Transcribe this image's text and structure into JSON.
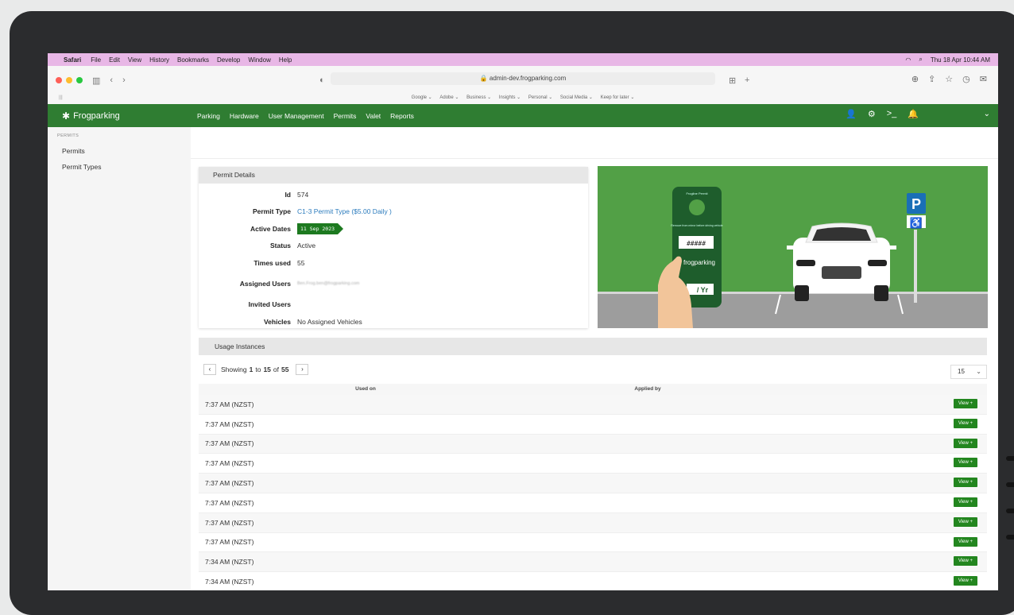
{
  "menubar": {
    "app": "Safari",
    "items": [
      "File",
      "Edit",
      "View",
      "History",
      "Bookmarks",
      "Develop",
      "Window",
      "Help"
    ],
    "clock": "Thu 18 Apr  10:44 AM"
  },
  "browser": {
    "url": "admin-dev.frogparking.com",
    "bookmarks": [
      "Google ⌄",
      "Adobe ⌄",
      "Business ⌄",
      "Insights ⌄",
      "Personal ⌄",
      "Social Media ⌄",
      "Keep for later ⌄"
    ]
  },
  "app": {
    "logo": "Frogparking",
    "nav": [
      "Parking",
      "Hardware",
      "User Management",
      "Permits",
      "Valet",
      "Reports"
    ]
  },
  "sidebar": {
    "heading": "PERMITS",
    "items": [
      "Permits",
      "Permit Types"
    ]
  },
  "permit_details": {
    "title": "Permit Details",
    "id_label": "Id",
    "id": "574",
    "type_label": "Permit Type",
    "type": "C1-3 Permit Type ($5.00 Daily )",
    "active_label": "Active Dates",
    "active": "11 Sep 2023",
    "status_label": "Status",
    "status": "Active",
    "times_label": "Times used",
    "times": "55",
    "assigned_label": "Assigned Users",
    "assigned": "Ben.Frog.ben@frogparking.com",
    "invited_label": "Invited Users",
    "vehicles_label": "Vehicles",
    "vehicles": "No Assigned Vehicles"
  },
  "illustration": {
    "hanger_title": "Frogline Permit",
    "hanger_note": "Remove from mirror before driving vehicle",
    "hanger_code": "#####",
    "hanger_brand": "frogparking",
    "hanger_year": "/ Yr",
    "sign": "P"
  },
  "usage": {
    "title": "Usage Instances",
    "showing": "Showing",
    "from": "1",
    "to_word": "to",
    "to": "15",
    "of_word": "of",
    "total": "55",
    "page_size": "15",
    "col_used": "Used on",
    "col_applied": "Applied by",
    "view_label": "View +",
    "rows": [
      "7:37 AM (NZST)",
      "7:37 AM (NZST)",
      "7:37 AM (NZST)",
      "7:37 AM (NZST)",
      "7:37 AM (NZST)",
      "7:37 AM (NZST)",
      "7:37 AM (NZST)",
      "7:37 AM (NZST)",
      "7:34 AM (NZST)",
      "7:34 AM (NZST)"
    ]
  },
  "colors": {
    "brand": "#2f7d32",
    "button": "#23861f",
    "menubar": "#e8b7e6"
  }
}
